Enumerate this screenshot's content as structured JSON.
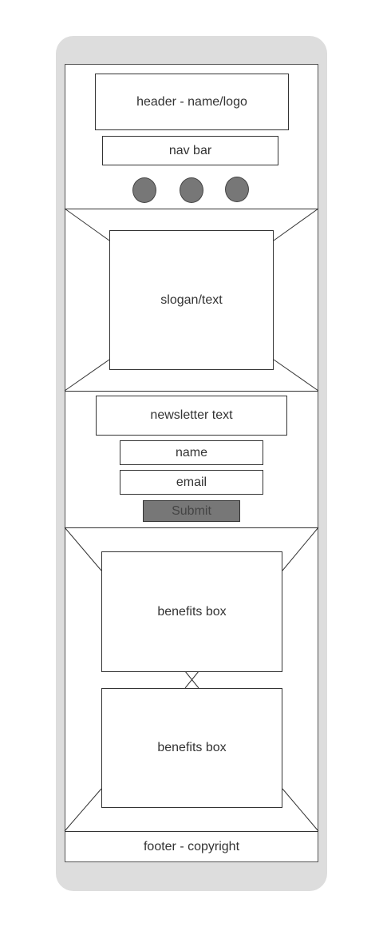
{
  "header": {
    "label": "header - name/logo"
  },
  "nav": {
    "label": "nav bar",
    "icons": [
      "circle-icon",
      "circle-icon",
      "circle-icon"
    ]
  },
  "hero": {
    "label": "slogan/text"
  },
  "newsletter": {
    "label": "newsletter text",
    "name_field": "name",
    "email_field": "email",
    "submit_label": "Submit"
  },
  "benefits": [
    {
      "label": "benefits box"
    },
    {
      "label": "benefits box"
    }
  ],
  "footer": {
    "label": "footer - copyright"
  },
  "colors": {
    "frame": "#dddddd",
    "line": "#333333",
    "dot_fill": "#777777",
    "submit_fill": "#777777"
  }
}
